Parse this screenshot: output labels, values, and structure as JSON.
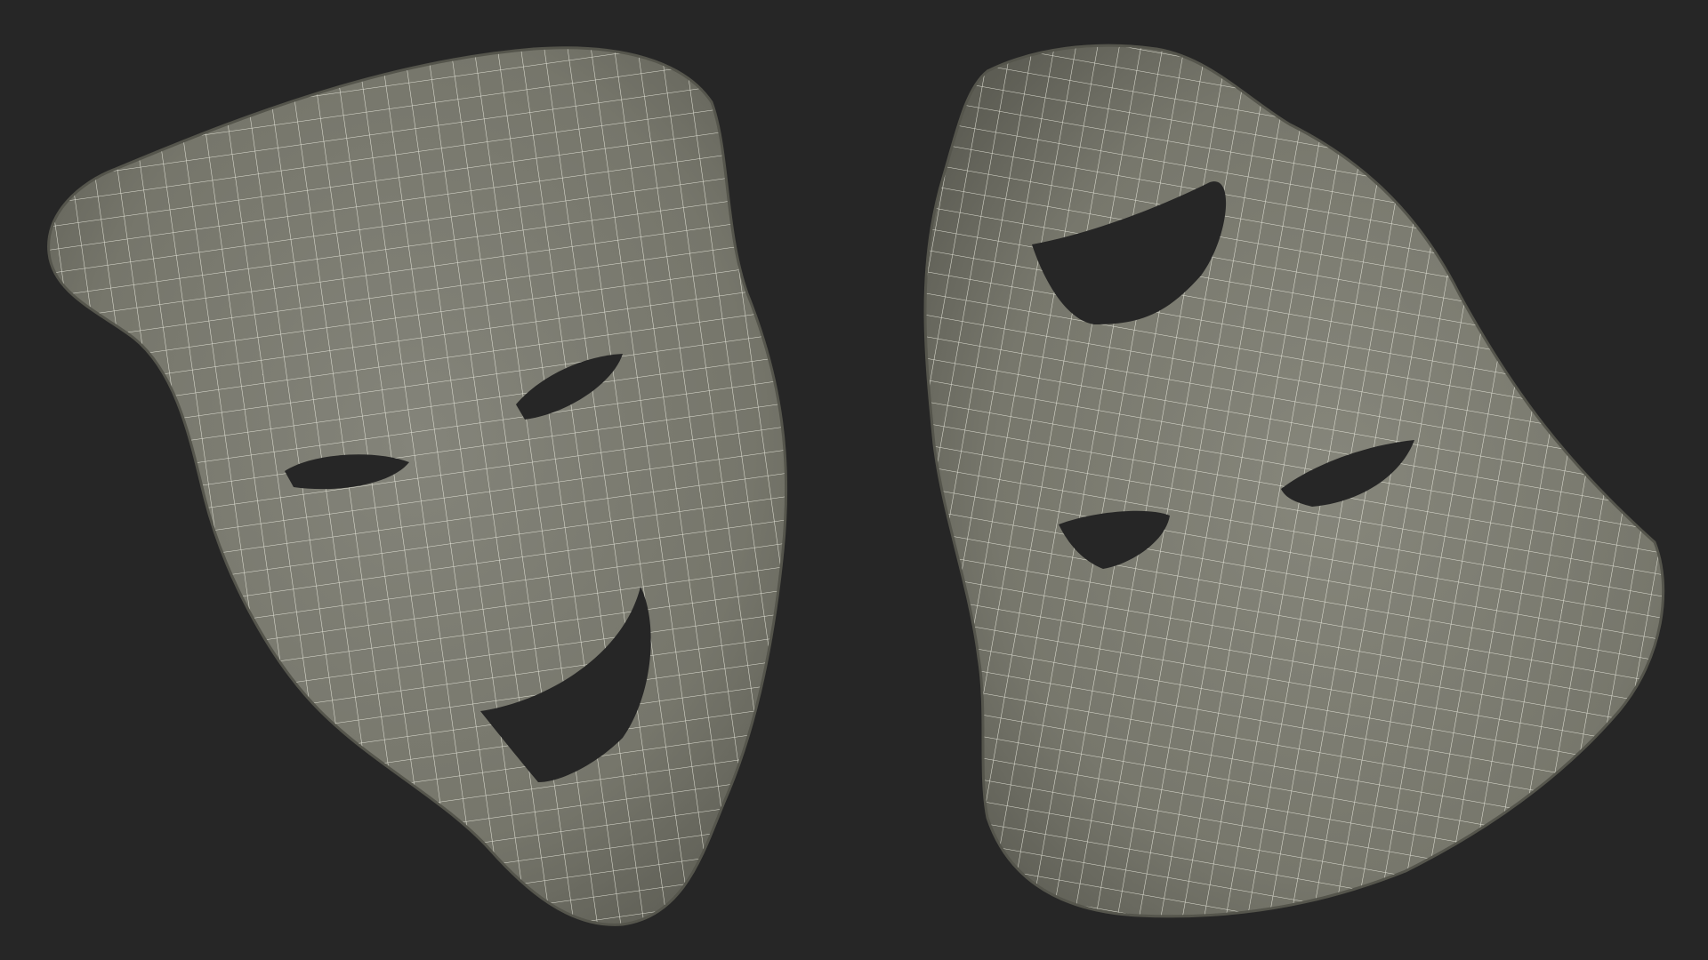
{
  "scene": {
    "background_color": "#262626",
    "surface_color": "#7b7b6e",
    "surface_shadow_color": "#5e5e54",
    "wire_color": "#f2f2e6",
    "objects": [
      {
        "name": "comedy-mask",
        "expression": "smiling"
      },
      {
        "name": "tragedy-mask",
        "expression": "frowning"
      }
    ]
  }
}
